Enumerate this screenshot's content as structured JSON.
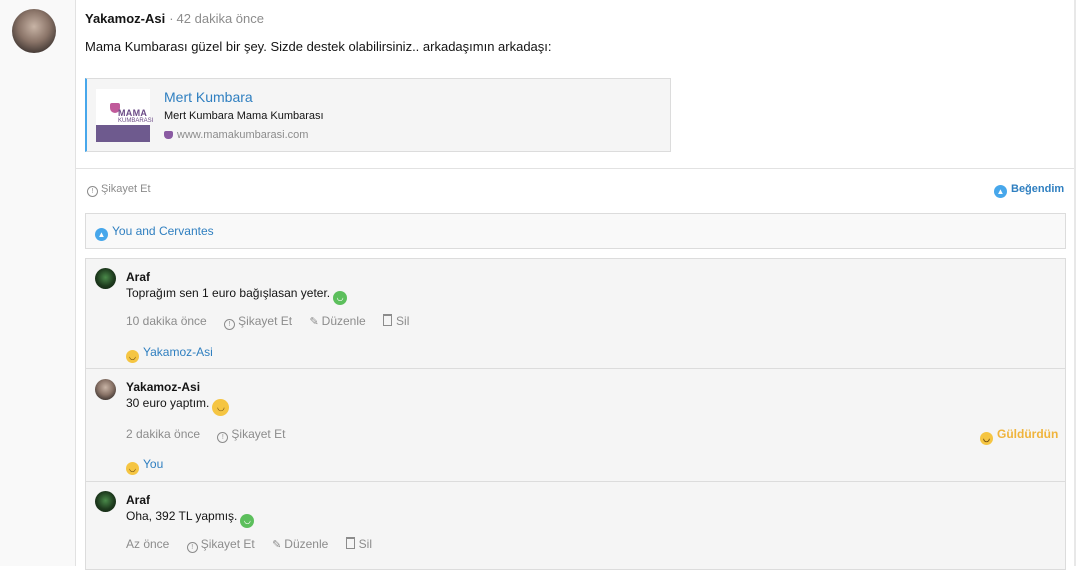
{
  "post": {
    "author": "Yakamoz-Asi",
    "separator": "·",
    "time": "42 dakika önce",
    "text": "Mama Kumbarası güzel bir şey. Sizde destek olabilirsiniz.. arkadaşımın arkadaşı:",
    "link_preview": {
      "thumb_line1": "MAMA",
      "thumb_line2": "KUMBARASI",
      "title": "Mert Kumbara",
      "description": "Mert Kumbara Mama Kumbarası",
      "url": "www.mamakumbarasi.com"
    },
    "report_label": "Şikayet Et",
    "like_label": "Beğendim",
    "likes_summary": "You and Cervantes"
  },
  "comments": [
    {
      "author": "Araf",
      "text": "Toprağım sen 1 euro bağışlasan yeter.",
      "time": "10 dakika önce",
      "report_label": "Şikayet Et",
      "edit_label": "Düzenle",
      "delete_label": "Sil",
      "reaction_by": "Yakamoz-Asi"
    },
    {
      "author": "Yakamoz-Asi",
      "text": "30 euro yaptım.",
      "time": "2 dakika önce",
      "report_label": "Şikayet Et",
      "laugh_label": "Güldürdün",
      "reaction_by": "You"
    },
    {
      "author": "Araf",
      "text": "Oha, 392 TL yapmış.",
      "time": "Az önce",
      "report_label": "Şikayet Et",
      "edit_label": "Düzenle",
      "delete_label": "Sil"
    }
  ],
  "colors": {
    "link_blue": "#2f7fc0",
    "like_blue": "#47a7eb",
    "laugh_yellow": "#f0b43c",
    "muted": "#8c8c8c"
  },
  "icons": [
    "warning-icon",
    "thumbs-up-icon",
    "pencil-icon",
    "trash-icon",
    "laugh-emoji-icon",
    "grin-emoji-icon"
  ]
}
